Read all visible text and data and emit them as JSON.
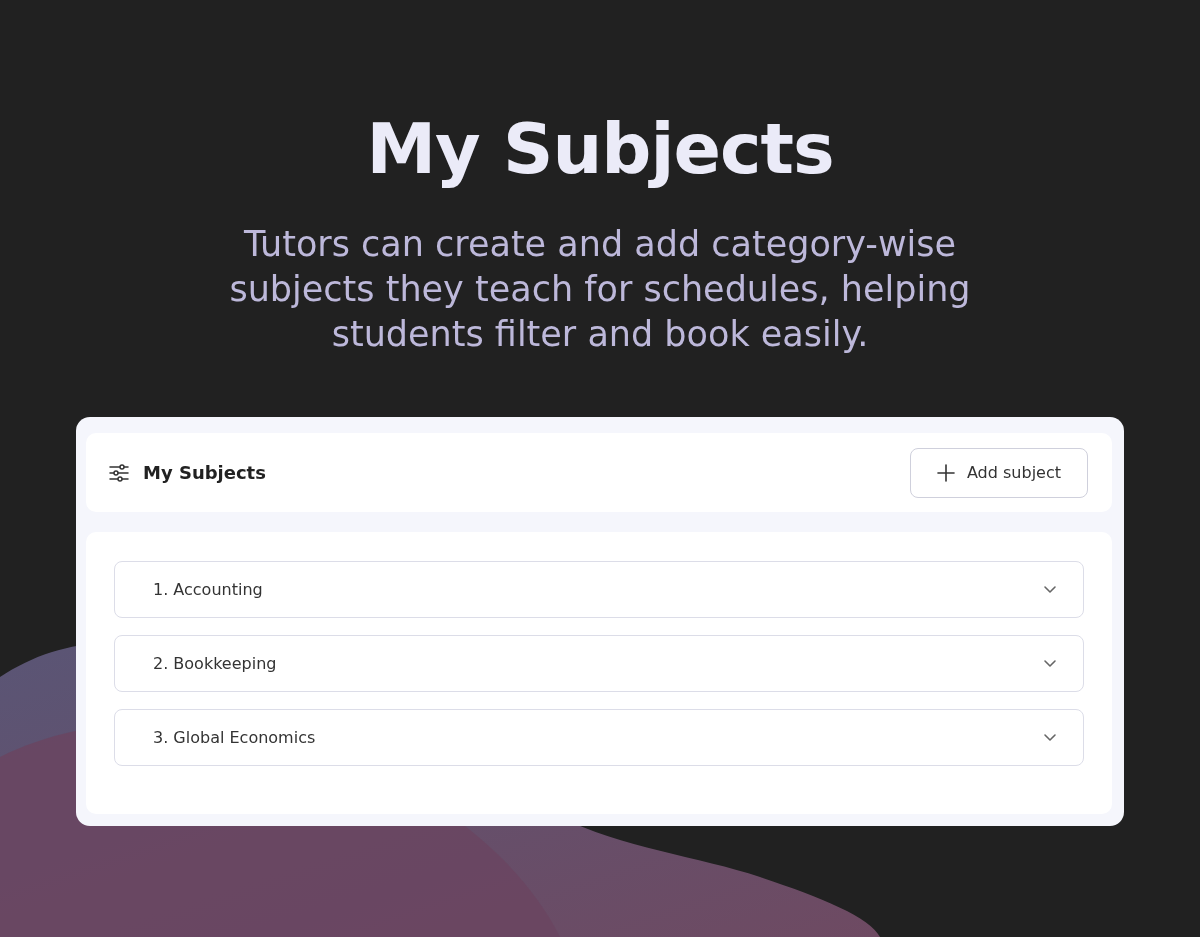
{
  "hero": {
    "title": "My Subjects",
    "subtitle": "Tutors can create and add category-wise subjects they teach for schedules, helping students filter and book easily."
  },
  "panel": {
    "title": "My Subjects",
    "add_button": "Add subject"
  },
  "subjects": [
    {
      "label": "1. Accounting",
      "expanded": false
    },
    {
      "label": "2. Bookkeeping",
      "expanded": false
    },
    {
      "label": "3. Global Economics",
      "expanded": false
    }
  ]
}
